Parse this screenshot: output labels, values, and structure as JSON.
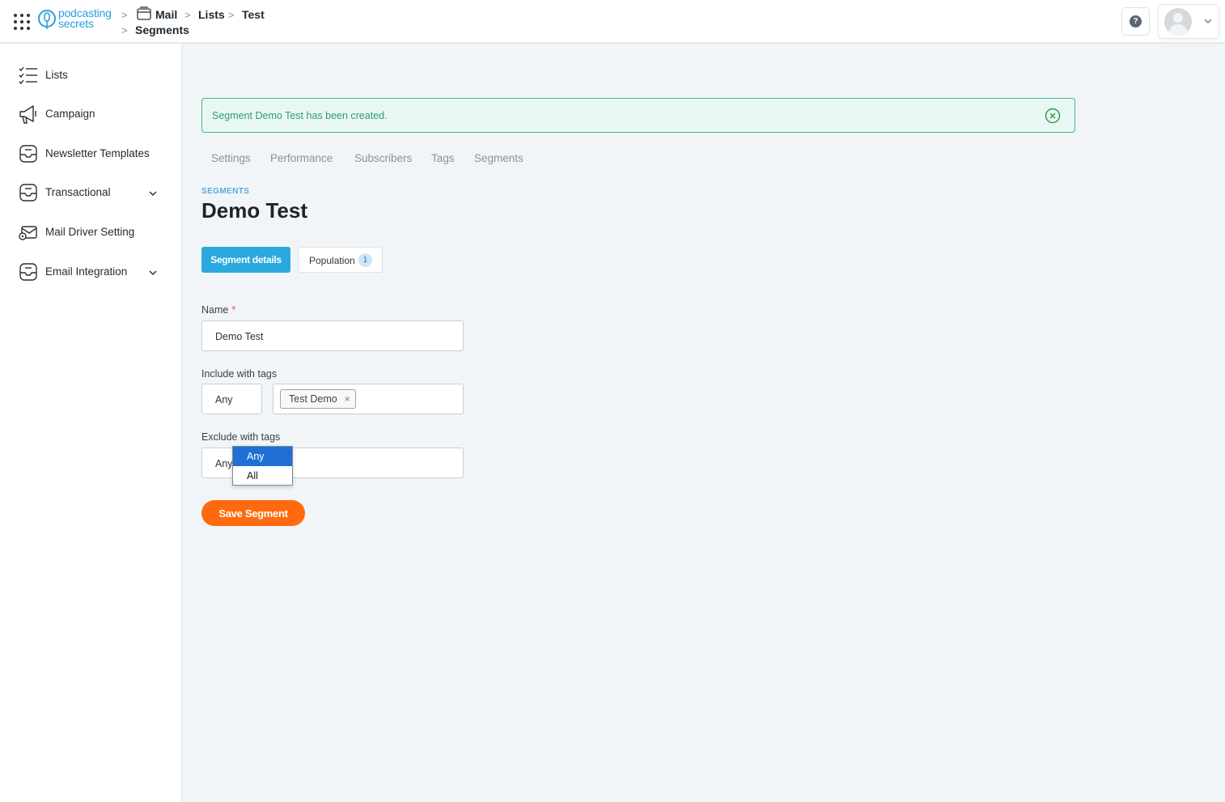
{
  "brand": {
    "logo_line1": "podcasting",
    "logo_line2": "secrets"
  },
  "breadcrumb": {
    "items": [
      "Mail",
      "Lists",
      "Test",
      "Segments"
    ]
  },
  "header": {
    "help_label": "?"
  },
  "sidebar": {
    "items": [
      {
        "label": "Lists",
        "icon": "list-check-icon"
      },
      {
        "label": "Campaign",
        "icon": "megaphone-icon"
      },
      {
        "label": "Newsletter Templates",
        "icon": "inbox-icon"
      },
      {
        "label": "Transactional",
        "icon": "inbox-icon",
        "expandable": true
      },
      {
        "label": "Mail Driver Setting",
        "icon": "mail-gear-icon"
      },
      {
        "label": "Email Integration",
        "icon": "inbox-icon",
        "expandable": true
      }
    ]
  },
  "alert": {
    "message": "Segment Demo Test has been created.",
    "color": "#47b98a"
  },
  "tabs": [
    "Settings",
    "Performance",
    "Subscribers",
    "Tags",
    "Segments"
  ],
  "page": {
    "eyebrow": "SEGMENTS",
    "title": "Demo Test"
  },
  "subtabs": {
    "details": "Segment details",
    "population": "Population",
    "population_count": "1"
  },
  "form": {
    "name_label": "Name",
    "required_mark": "*",
    "name_value": "Demo Test",
    "include_label": "Include with tags",
    "include_mode": "Any",
    "include_tags": [
      "Test Demo"
    ],
    "tag_remove": "×",
    "exclude_label": "Exclude with tags",
    "exclude_mode": "Any",
    "exclude_options": [
      "Any",
      "All"
    ],
    "save_label": "Save Segment"
  },
  "colors": {
    "primary": "#2aa9dd",
    "save": "#ff6a10",
    "dropdown_selected": "#1f6fd6"
  }
}
